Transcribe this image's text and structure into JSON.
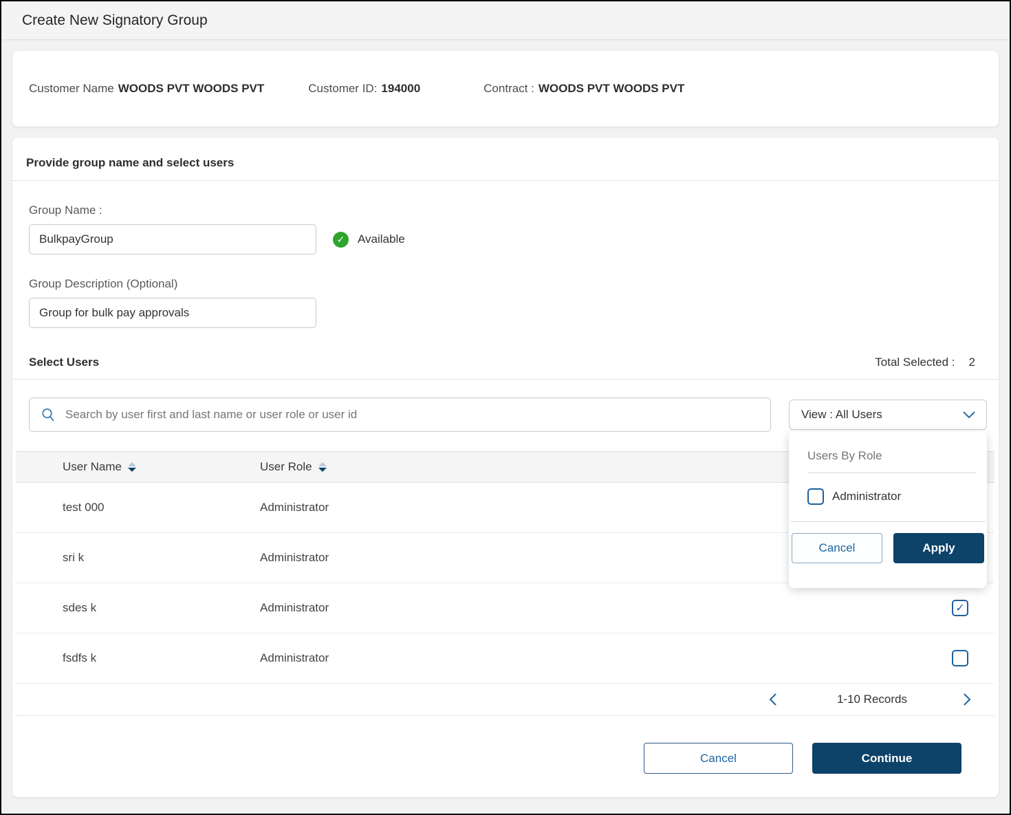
{
  "page": {
    "title": "Create New Signatory Group"
  },
  "customer": {
    "name_label": "Customer Name",
    "name_value": "WOODS PVT WOODS PVT",
    "id_label": "Customer ID:",
    "id_value": "194000",
    "contract_label": "Contract :",
    "contract_value": "WOODS PVT WOODS PVT"
  },
  "form": {
    "section_title": "Provide group name and select users",
    "group_name_label": "Group Name :",
    "group_name_value": "BulkpayGroup",
    "availability_status": "Available",
    "group_desc_label": "Group Description (Optional)",
    "group_desc_value": "Group for bulk pay approvals"
  },
  "select_users": {
    "title": "Select Users",
    "total_selected_label": "Total Selected :",
    "total_selected_value": "2",
    "search_placeholder": "Search by user first and last name or user role or user id",
    "view_dropdown": {
      "label": "View : All Users",
      "panel": {
        "heading": "Users By Role",
        "options": [
          {
            "label": "Administrator",
            "checked": false
          }
        ],
        "cancel_label": "Cancel",
        "apply_label": "Apply"
      }
    }
  },
  "table": {
    "columns": [
      "User Name",
      "User Role"
    ],
    "rows": [
      {
        "name": "test 000",
        "role": "Administrator",
        "selected": null
      },
      {
        "name": "sri k",
        "role": "Administrator",
        "selected": null
      },
      {
        "name": "sdes k",
        "role": "Administrator",
        "selected": true
      },
      {
        "name": "fsdfs k",
        "role": "Administrator",
        "selected": false
      }
    ],
    "pagination": {
      "label": "1-10 Records"
    }
  },
  "footer": {
    "cancel_label": "Cancel",
    "continue_label": "Continue"
  },
  "icons": {
    "check": "✓"
  },
  "colors": {
    "accent_blue": "#1d66a5",
    "navy": "#0d4269",
    "green": "#2ea52c"
  }
}
